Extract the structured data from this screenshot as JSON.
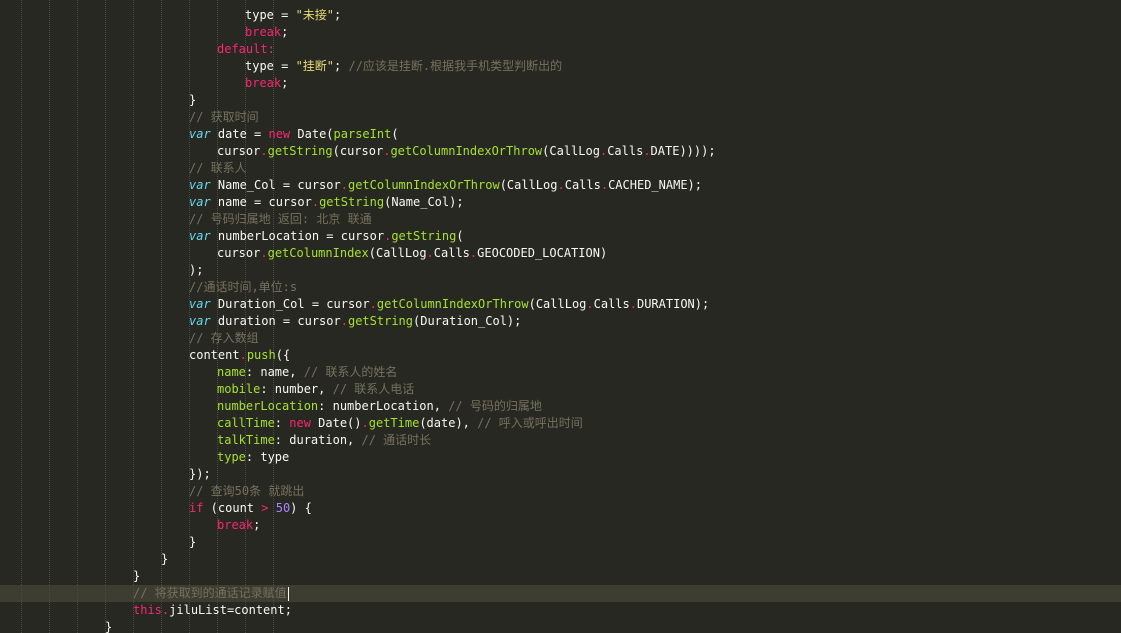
{
  "editor": {
    "theme": {
      "background": "#272822",
      "active_line": "#3e3d32"
    },
    "lines": [
      {
        "indent": 8,
        "tokens": [
          {
            "c": "t-plain",
            "v": "type = "
          },
          {
            "c": "t-str",
            "v": "\"未接\""
          },
          {
            "c": "t-plain",
            "v": ";"
          }
        ]
      },
      {
        "indent": 8,
        "tokens": [
          {
            "c": "t-kw",
            "v": "break"
          },
          {
            "c": "t-plain",
            "v": ";"
          }
        ]
      },
      {
        "indent": 7,
        "tokens": [
          {
            "c": "t-kw",
            "v": "default:"
          }
        ]
      },
      {
        "indent": 8,
        "tokens": [
          {
            "c": "t-plain",
            "v": "type = "
          },
          {
            "c": "t-str",
            "v": "\"挂断\""
          },
          {
            "c": "t-plain",
            "v": "; "
          },
          {
            "c": "t-cmt",
            "v": "//应该是挂断.根据我手机类型判断出的"
          }
        ]
      },
      {
        "indent": 8,
        "tokens": [
          {
            "c": "t-kw",
            "v": "break"
          },
          {
            "c": "t-plain",
            "v": ";"
          }
        ]
      },
      {
        "indent": 6,
        "tokens": [
          {
            "c": "t-plain",
            "v": "}"
          }
        ]
      },
      {
        "indent": 6,
        "tokens": [
          {
            "c": "t-cmt",
            "v": "// 获取时间"
          }
        ]
      },
      {
        "indent": 6,
        "tokens": [
          {
            "c": "t-type",
            "v": "var"
          },
          {
            "c": "t-plain",
            "v": " date = "
          },
          {
            "c": "t-kw",
            "v": "new"
          },
          {
            "c": "t-plain",
            "v": " Date("
          },
          {
            "c": "t-fn",
            "v": "parseInt"
          },
          {
            "c": "t-plain",
            "v": "("
          }
        ]
      },
      {
        "indent": 7,
        "tokens": [
          {
            "c": "t-plain",
            "v": "cursor"
          },
          {
            "c": "t-op",
            "v": "."
          },
          {
            "c": "t-fn",
            "v": "getString"
          },
          {
            "c": "t-plain",
            "v": "(cursor"
          },
          {
            "c": "t-op",
            "v": "."
          },
          {
            "c": "t-fn",
            "v": "getColumnIndexOrThrow"
          },
          {
            "c": "t-plain",
            "v": "(CallLog"
          },
          {
            "c": "t-op",
            "v": "."
          },
          {
            "c": "t-plain",
            "v": "Calls"
          },
          {
            "c": "t-op",
            "v": "."
          },
          {
            "c": "t-plain",
            "v": "DATE))));"
          }
        ]
      },
      {
        "indent": 6,
        "tokens": [
          {
            "c": "t-cmt",
            "v": "// 联系人"
          }
        ]
      },
      {
        "indent": 6,
        "tokens": [
          {
            "c": "t-type",
            "v": "var"
          },
          {
            "c": "t-plain",
            "v": " Name_Col = cursor"
          },
          {
            "c": "t-op",
            "v": "."
          },
          {
            "c": "t-fn",
            "v": "getColumnIndexOrThrow"
          },
          {
            "c": "t-plain",
            "v": "(CallLog"
          },
          {
            "c": "t-op",
            "v": "."
          },
          {
            "c": "t-plain",
            "v": "Calls"
          },
          {
            "c": "t-op",
            "v": "."
          },
          {
            "c": "t-plain",
            "v": "CACHED_NAME);"
          }
        ]
      },
      {
        "indent": 6,
        "tokens": [
          {
            "c": "t-type",
            "v": "var"
          },
          {
            "c": "t-plain",
            "v": " name = cursor"
          },
          {
            "c": "t-op",
            "v": "."
          },
          {
            "c": "t-fn",
            "v": "getString"
          },
          {
            "c": "t-plain",
            "v": "(Name_Col);"
          }
        ]
      },
      {
        "indent": 6,
        "tokens": [
          {
            "c": "t-cmt",
            "v": "// 号码归属地 返回: 北京 联通"
          }
        ]
      },
      {
        "indent": 6,
        "tokens": [
          {
            "c": "t-type",
            "v": "var"
          },
          {
            "c": "t-plain",
            "v": " numberLocation = cursor"
          },
          {
            "c": "t-op",
            "v": "."
          },
          {
            "c": "t-fn",
            "v": "getString"
          },
          {
            "c": "t-plain",
            "v": "("
          }
        ]
      },
      {
        "indent": 7,
        "tokens": [
          {
            "c": "t-plain",
            "v": "cursor"
          },
          {
            "c": "t-op",
            "v": "."
          },
          {
            "c": "t-fn",
            "v": "getColumnIndex"
          },
          {
            "c": "t-plain",
            "v": "(CallLog"
          },
          {
            "c": "t-op",
            "v": "."
          },
          {
            "c": "t-plain",
            "v": "Calls"
          },
          {
            "c": "t-op",
            "v": "."
          },
          {
            "c": "t-plain",
            "v": "GEOCODED_LOCATION)"
          }
        ]
      },
      {
        "indent": 6,
        "tokens": [
          {
            "c": "t-plain",
            "v": ");"
          }
        ]
      },
      {
        "indent": 6,
        "tokens": [
          {
            "c": "t-cmt",
            "v": "//通话时间,单位:s"
          }
        ]
      },
      {
        "indent": 6,
        "tokens": [
          {
            "c": "t-type",
            "v": "var"
          },
          {
            "c": "t-plain",
            "v": " Duration_Col = cursor"
          },
          {
            "c": "t-op",
            "v": "."
          },
          {
            "c": "t-fn",
            "v": "getColumnIndexOrThrow"
          },
          {
            "c": "t-plain",
            "v": "(CallLog"
          },
          {
            "c": "t-op",
            "v": "."
          },
          {
            "c": "t-plain",
            "v": "Calls"
          },
          {
            "c": "t-op",
            "v": "."
          },
          {
            "c": "t-plain",
            "v": "DURATION);"
          }
        ]
      },
      {
        "indent": 6,
        "tokens": [
          {
            "c": "t-type",
            "v": "var"
          },
          {
            "c": "t-plain",
            "v": " duration = cursor"
          },
          {
            "c": "t-op",
            "v": "."
          },
          {
            "c": "t-fn",
            "v": "getString"
          },
          {
            "c": "t-plain",
            "v": "(Duration_Col);"
          }
        ]
      },
      {
        "indent": 6,
        "tokens": [
          {
            "c": "t-cmt",
            "v": "// 存入数组"
          }
        ]
      },
      {
        "indent": 6,
        "tokens": [
          {
            "c": "t-plain",
            "v": "content"
          },
          {
            "c": "t-op",
            "v": "."
          },
          {
            "c": "t-fn",
            "v": "push"
          },
          {
            "c": "t-plain",
            "v": "({"
          }
        ]
      },
      {
        "indent": 7,
        "tokens": [
          {
            "c": "t-prop",
            "v": "name"
          },
          {
            "c": "t-plain",
            "v": ": name, "
          },
          {
            "c": "t-cmt",
            "v": "// 联系人的姓名"
          }
        ]
      },
      {
        "indent": 7,
        "tokens": [
          {
            "c": "t-prop",
            "v": "mobile"
          },
          {
            "c": "t-plain",
            "v": ": number, "
          },
          {
            "c": "t-cmt",
            "v": "// 联系人电话"
          }
        ]
      },
      {
        "indent": 7,
        "tokens": [
          {
            "c": "t-prop",
            "v": "numberLocation"
          },
          {
            "c": "t-plain",
            "v": ": numberLocation, "
          },
          {
            "c": "t-cmt",
            "v": "// 号码的归属地"
          }
        ]
      },
      {
        "indent": 7,
        "tokens": [
          {
            "c": "t-prop",
            "v": "callTime"
          },
          {
            "c": "t-plain",
            "v": ": "
          },
          {
            "c": "t-kw",
            "v": "new"
          },
          {
            "c": "t-plain",
            "v": " Date()"
          },
          {
            "c": "t-op",
            "v": "."
          },
          {
            "c": "t-fn",
            "v": "getTime"
          },
          {
            "c": "t-plain",
            "v": "(date), "
          },
          {
            "c": "t-cmt",
            "v": "// 呼入或呼出时间"
          }
        ]
      },
      {
        "indent": 7,
        "tokens": [
          {
            "c": "t-prop",
            "v": "talkTime"
          },
          {
            "c": "t-plain",
            "v": ": duration, "
          },
          {
            "c": "t-cmt",
            "v": "// 通话时长"
          }
        ]
      },
      {
        "indent": 7,
        "tokens": [
          {
            "c": "t-prop",
            "v": "type"
          },
          {
            "c": "t-plain",
            "v": ": type"
          }
        ]
      },
      {
        "indent": 6,
        "tokens": [
          {
            "c": "t-plain",
            "v": "});"
          }
        ]
      },
      {
        "indent": 6,
        "tokens": [
          {
            "c": "t-cmt",
            "v": "// 查询50条 就跳出"
          }
        ]
      },
      {
        "indent": 6,
        "tokens": [
          {
            "c": "t-kw",
            "v": "if"
          },
          {
            "c": "t-plain",
            "v": " (count "
          },
          {
            "c": "t-op",
            "v": ">"
          },
          {
            "c": "t-plain",
            "v": " "
          },
          {
            "c": "t-num",
            "v": "50"
          },
          {
            "c": "t-plain",
            "v": ") {"
          }
        ]
      },
      {
        "indent": 7,
        "tokens": [
          {
            "c": "t-kw",
            "v": "break"
          },
          {
            "c": "t-plain",
            "v": ";"
          }
        ]
      },
      {
        "indent": 6,
        "tokens": [
          {
            "c": "t-plain",
            "v": "}"
          }
        ]
      },
      {
        "indent": 5,
        "tokens": [
          {
            "c": "t-plain",
            "v": "}"
          }
        ]
      },
      {
        "indent": 4,
        "tokens": [
          {
            "c": "t-plain",
            "v": "}"
          }
        ]
      },
      {
        "indent": 4,
        "tokens": [
          {
            "c": "t-cmt",
            "v": "// 将获取到的通话记录赋值"
          }
        ],
        "cursor": true
      },
      {
        "indent": 4,
        "tokens": [
          {
            "c": "t-kw",
            "v": "this"
          },
          {
            "c": "t-op",
            "v": "."
          },
          {
            "c": "t-plain",
            "v": "jiluList=content;"
          }
        ]
      },
      {
        "indent": 3,
        "tokens": [
          {
            "c": "t-plain",
            "v": "}"
          }
        ]
      }
    ]
  }
}
